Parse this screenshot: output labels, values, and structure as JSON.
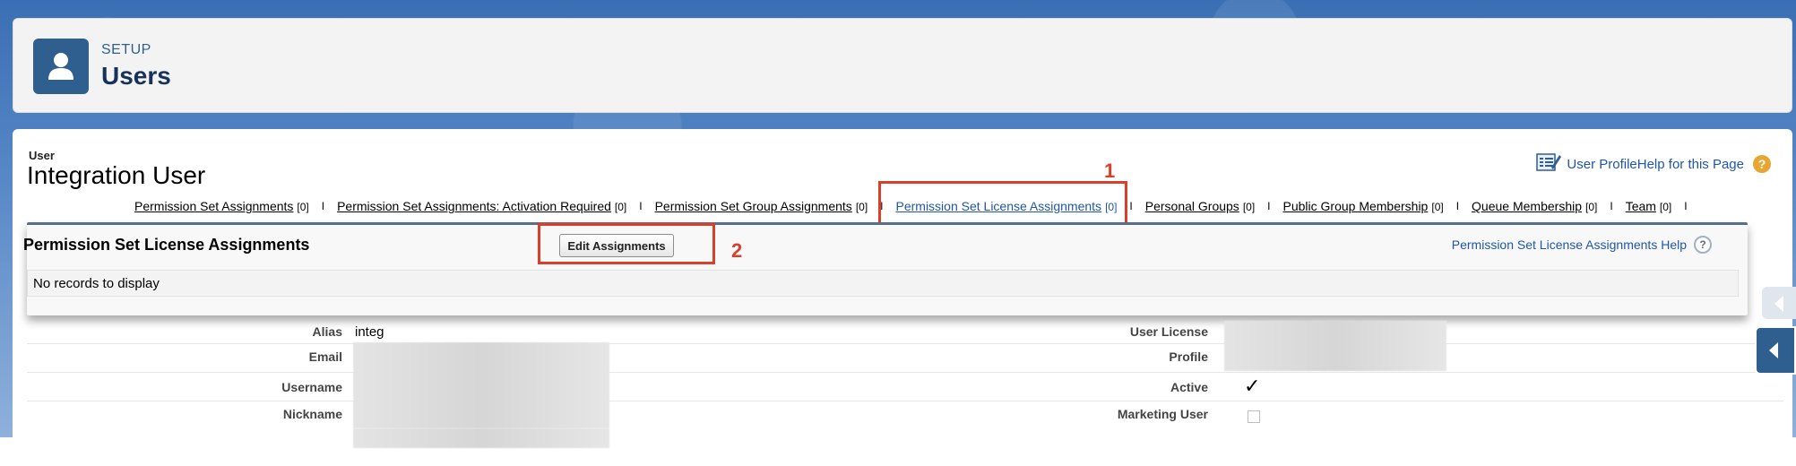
{
  "header": {
    "setup_label": "SETUP",
    "title": "Users"
  },
  "user": {
    "label": "User",
    "name": "Integration User"
  },
  "help": {
    "profile_help": "User ProfileHelp for this Page",
    "help_glyph": "?"
  },
  "related_tabs": [
    {
      "label": "Permission Set Assignments",
      "count": "[0]"
    },
    {
      "label": "Permission Set Assignments: Activation Required",
      "count": "[0]"
    },
    {
      "label": "Permission Set Group Assignments",
      "count": "[0]"
    },
    {
      "label": "Permission Set License Assignments",
      "count": "[0]"
    },
    {
      "label": "Personal Groups",
      "count": "[0]"
    },
    {
      "label": "Public Group Membership",
      "count": "[0]"
    },
    {
      "label": "Queue Membership",
      "count": "[0]"
    },
    {
      "label": "Team",
      "count": "[0]"
    }
  ],
  "separator": "I",
  "annotations": {
    "one": "1",
    "two": "2"
  },
  "panel": {
    "title": "Permission Set License Assignments",
    "edit_button": "Edit Assignments",
    "help_link": "Permission Set License Assignments Help",
    "help_glyph": "?",
    "empty_message": "No records to display"
  },
  "details": {
    "alias_label": "Alias",
    "alias_value": "integ",
    "email_label": "Email",
    "username_label": "Username",
    "nickname_label": "Nickname",
    "user_license_label": "User License",
    "profile_label": "Profile",
    "active_label": "Active",
    "active_check": "✓",
    "marketing_user_label": "Marketing User"
  },
  "colors": {
    "annotation": "#d9402b",
    "link": "#1f56a8",
    "brand": "#2f5f8f"
  }
}
